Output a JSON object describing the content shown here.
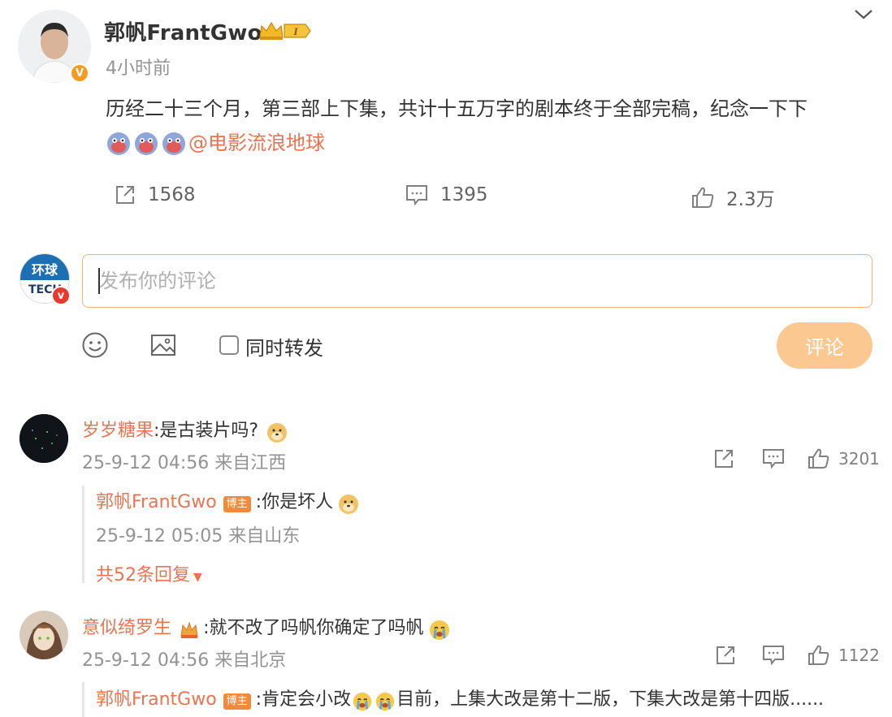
{
  "post": {
    "author": "郭帆FrantGwo",
    "author_badge": "V",
    "level_badge": "I",
    "time": "4小时前",
    "text": "历经二十三个月，第三部上下集，共计十五万字的剧本终于全部完稿，纪念一下下",
    "mention": "@电影流浪地球",
    "emoji_count": 3,
    "actions": {
      "repost_count": "1568",
      "comment_count": "1395",
      "like_count": "2.3万"
    }
  },
  "composer": {
    "avatar_top": "环球",
    "avatar_bottom": "TECH",
    "placeholder": "发布你的评论",
    "repost_label": "同时转发",
    "submit_label": "评论"
  },
  "comments": [
    {
      "user": "岁岁糖果",
      "text": ":是古装片吗?",
      "meta": "25-9-12 04:56 来自江西",
      "likes": "3201",
      "reply": {
        "user": "郭帆FrantGwo",
        "badge": "博主",
        "text": ":你是坏人",
        "meta": "25-9-12 05:05 来自山东"
      },
      "more_replies": "共52条回复"
    },
    {
      "user": "意似绮罗生",
      "text": ":就不改了吗帆你确定了吗帆",
      "meta": "25-9-12 04:56 来自北京",
      "likes": "1122",
      "reply": {
        "user": "郭帆FrantGwo",
        "badge": "博主",
        "text": ":肯定会小改",
        "text2": "目前，上集大改是第十二版，下集大改是第十四版......"
      }
    }
  ],
  "colors": {
    "accent": "#eb7350",
    "submit": "#fbc891",
    "border_focus": "#f6b174",
    "verified": "#f59a23"
  }
}
